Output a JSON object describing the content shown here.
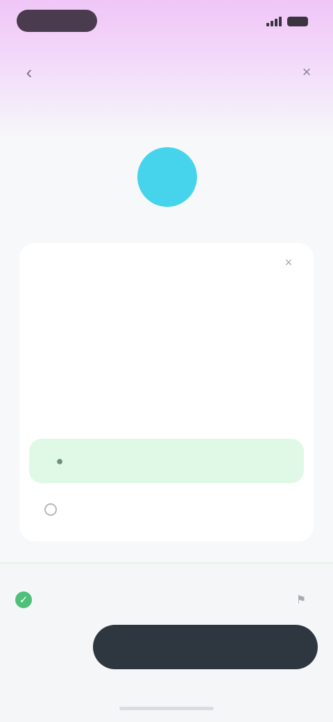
{
  "status_bar": {
    "icons": [
      "signal-icon",
      "wifi-icon",
      "battery-icon"
    ]
  },
  "nav": {
    "back_icon": "back-arrow-icon",
    "title": "",
    "close_icon": "close-icon",
    "sub_label": ""
  },
  "hero": {
    "icon": "mascot-icon",
    "color": "#46d4ec"
  },
  "card": {
    "label": "",
    "close_icon": "close-icon",
    "question": "",
    "answer_option": "",
    "hint_label": ""
  },
  "bottom": {
    "result_label": "",
    "result_color": "#4ec07a",
    "flag_icon": "flag-icon",
    "secondary_link": "",
    "primary_button": ""
  },
  "colors": {
    "accent_gradient_top": "#f0c6f7",
    "answer_bg": "#dff9e6",
    "button_bg": "#2e3640"
  }
}
